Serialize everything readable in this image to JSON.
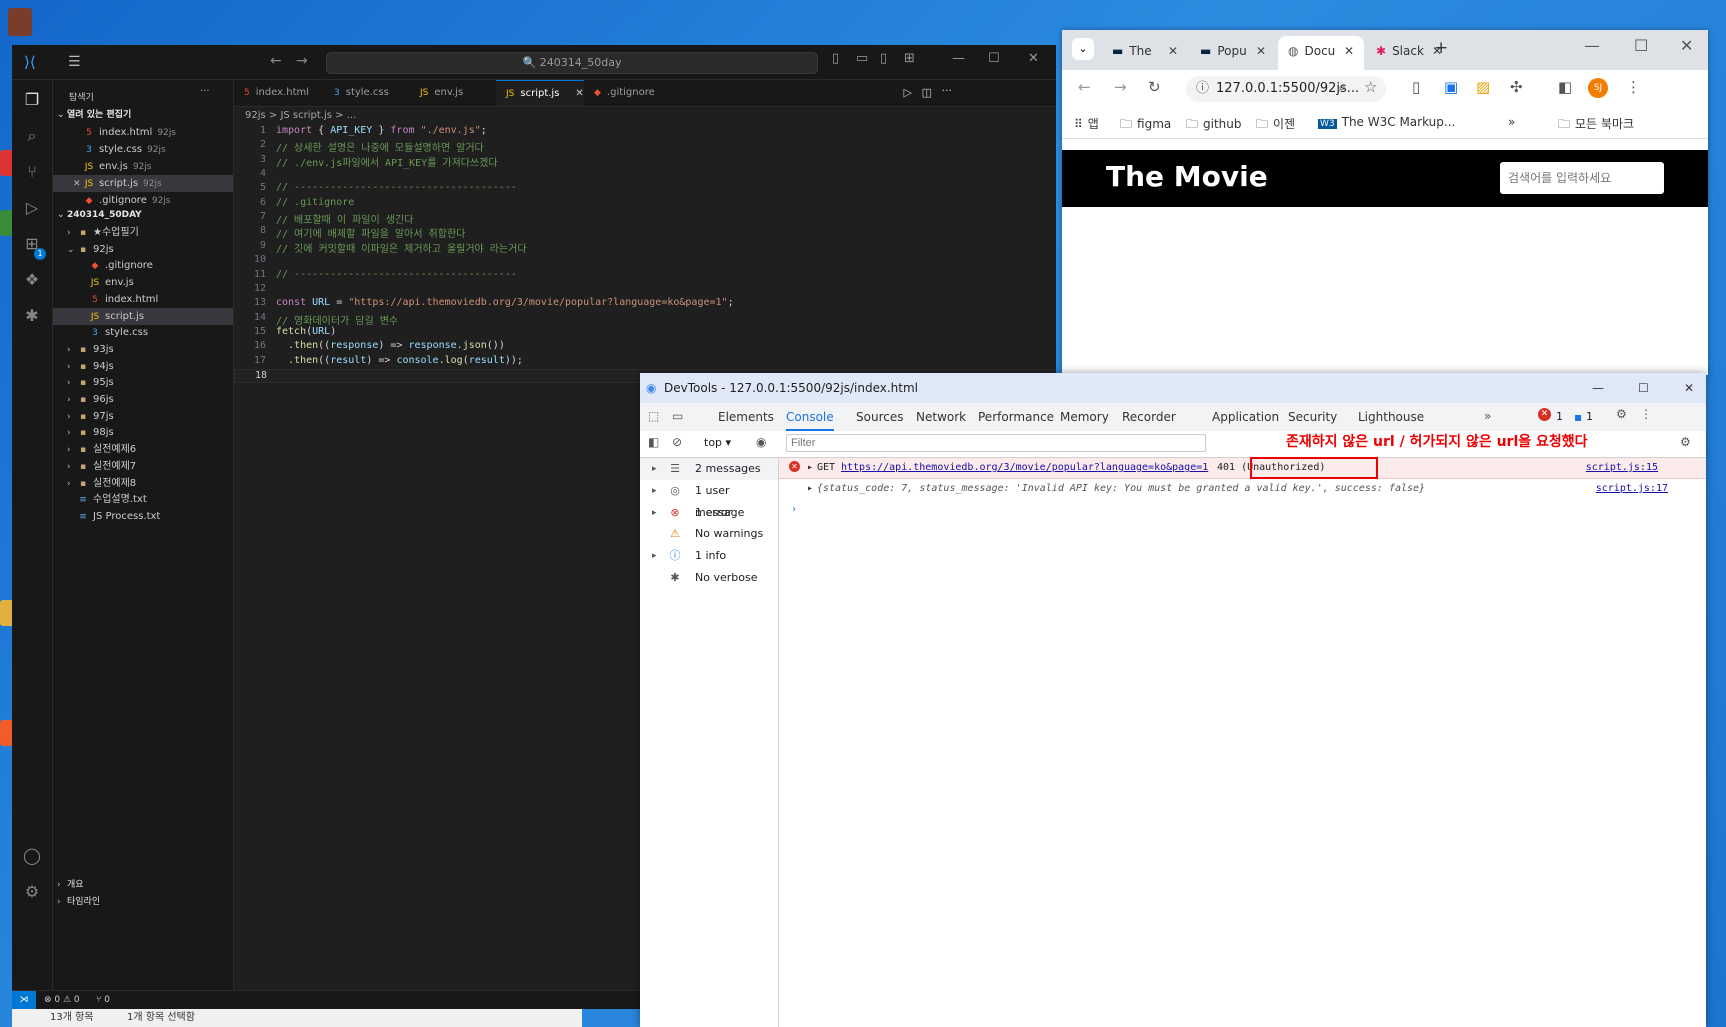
{
  "vscode": {
    "search_text": "240314_50day",
    "sidebar_title": "탐색기",
    "open_editors_header": "열려 있는 편집기",
    "open_editors": [
      {
        "name": "index.html",
        "desc": "92js",
        "type": "html"
      },
      {
        "name": "style.css",
        "desc": "92js",
        "type": "css"
      },
      {
        "name": "env.js",
        "desc": "92js",
        "type": "js"
      },
      {
        "name": "script.js",
        "desc": "92js",
        "type": "js"
      },
      {
        "name": ".gitignore",
        "desc": "92js",
        "type": "git"
      }
    ],
    "project_header": "240314_50DAY",
    "tree": [
      {
        "name": "★수업필기",
        "type": "folder"
      },
      {
        "name": "92js",
        "type": "folder-open"
      },
      {
        "name": ".gitignore",
        "type": "git"
      },
      {
        "name": "env.js",
        "type": "js"
      },
      {
        "name": "index.html",
        "type": "html"
      },
      {
        "name": "script.js",
        "type": "js"
      },
      {
        "name": "style.css",
        "type": "css"
      },
      {
        "name": "93js",
        "type": "folder"
      },
      {
        "name": "94js",
        "type": "folder"
      },
      {
        "name": "95js",
        "type": "folder"
      },
      {
        "name": "96js",
        "type": "folder"
      },
      {
        "name": "97js",
        "type": "folder"
      },
      {
        "name": "98js",
        "type": "folder"
      },
      {
        "name": "실전예제6",
        "type": "folder"
      },
      {
        "name": "실전예제7",
        "type": "folder"
      },
      {
        "name": "실전예제8",
        "type": "folder"
      },
      {
        "name": "수업설명.txt",
        "type": "txt"
      },
      {
        "name": "JS Process.txt",
        "type": "txt"
      }
    ],
    "outline_label": "개요",
    "timeline_label": "타임라인",
    "tabs": [
      {
        "label": "index.html",
        "type": "html"
      },
      {
        "label": "style.css",
        "type": "css"
      },
      {
        "label": "env.js",
        "type": "js"
      },
      {
        "label": "script.js",
        "type": "js"
      },
      {
        "label": ".gitignore",
        "type": "git"
      }
    ],
    "breadcrumb": "92js > JS script.js > ...",
    "code": [
      "import { API_KEY } from \"./env.js\";",
      "// 상세한 설명은 나중에 모듈설명하면 알거다",
      "// ./env.js파일에서 API_KEY를 가져다쓰겠다",
      "",
      "// -------------------------------------",
      "// .gitignore",
      "// 배포할때 이 파일이 생긴다",
      "// 여기에 배제할 파일을 알아서 취합한다",
      "// 깃에 커밋할때 이파일은 제거하고 올릴거야 라는거다",
      "",
      "// -------------------------------------",
      "",
      "const URL = \"https://api.themoviedb.org/3/movie/popular?language=ko&page=1\";",
      "// 영화데이터가 담길 변수",
      "fetch(URL)",
      "  .then((response) => response.json())",
      "  .then((result) => console.log(result));",
      ""
    ],
    "status_left": "⊗ 0 ⚠ 0",
    "status_ports": "⑂ 0"
  },
  "explorer_status": {
    "items": "13개 항목",
    "selected": "1개 항목 선택함"
  },
  "chrome": {
    "tabs": [
      "The",
      "Popu",
      "Docu",
      "Slack"
    ],
    "url": "127.0.0.1:5500/92js...",
    "bookmarks": [
      "앱",
      "figma",
      "github",
      "이젠",
      "The W3C Markup..."
    ],
    "all_bookmarks": "모든 북마크",
    "profile": "SJ",
    "page_title": "The Movie",
    "search_placeholder": "검색어를 입력하세요"
  },
  "devtools": {
    "title": "DevTools - 127.0.0.1:5500/92js/index.html",
    "tabs": [
      "Elements",
      "Console",
      "Sources",
      "Network",
      "Performance",
      "Memory",
      "Recorder",
      "Application",
      "Security",
      "Lighthouse"
    ],
    "active_tab": "Console",
    "error_count": "1",
    "info_count": "1",
    "context": "top",
    "filter_placeholder": "Filter",
    "sidebar": [
      {
        "label": "2 messages",
        "icon": "list-icon"
      },
      {
        "label": "1 user message",
        "icon": "user-icon"
      },
      {
        "label": "1 error",
        "icon": "error-icon"
      },
      {
        "label": "No warnings",
        "icon": "warning-icon"
      },
      {
        "label": "1 info",
        "icon": "info-icon"
      },
      {
        "label": "No verbose",
        "icon": "bug-icon"
      }
    ],
    "error_method": "GET",
    "error_url": "https://api.themoviedb.org/3/movie/popular?language=ko&page=1",
    "error_status": "401 (Unauthorized)",
    "error_source": "script.js:15",
    "log_text": "{status_code: 7, status_message: 'Invalid API key: You must be granted a valid key.', success: false}",
    "log_source": "script.js:17",
    "annotation": "존재하지 않은 url / 허가되지 않은 url을 요청했다"
  },
  "colors": {
    "vscode_bg": "#1f1f1f",
    "accent": "#0078d4",
    "error_red": "#e00000"
  }
}
